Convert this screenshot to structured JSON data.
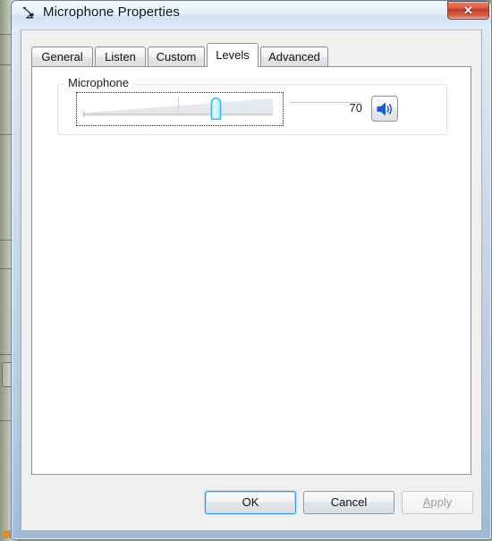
{
  "window": {
    "title": "Microphone Properties",
    "icon": "microphone-icon",
    "close_label": "x"
  },
  "tabs": [
    {
      "label": "General",
      "selected": false
    },
    {
      "label": "Listen",
      "selected": false
    },
    {
      "label": "Custom",
      "selected": false
    },
    {
      "label": "Levels",
      "selected": true
    },
    {
      "label": "Advanced",
      "selected": false
    }
  ],
  "levels_page": {
    "group": {
      "legend": "Microphone",
      "slider": {
        "value": 70,
        "min": 0,
        "max": 100,
        "focused": true,
        "tick_at": 50
      },
      "value_text": "70",
      "mute_button": {
        "icon": "speaker-on-icon",
        "muted": false
      }
    }
  },
  "footer": {
    "ok_label": "OK",
    "cancel_label": "Cancel",
    "apply_label": "Apply",
    "apply_accelerator": "A",
    "apply_enabled": false,
    "default_button": "OK"
  },
  "colors": {
    "accent_blue": "#3c9ad8",
    "close_red": "#bc3a25",
    "thumb_border": "#2bb6d9",
    "speaker_blue": "#1f5fc4",
    "body_bg": "#f0f0f0",
    "page_bg": "#ffffff"
  }
}
